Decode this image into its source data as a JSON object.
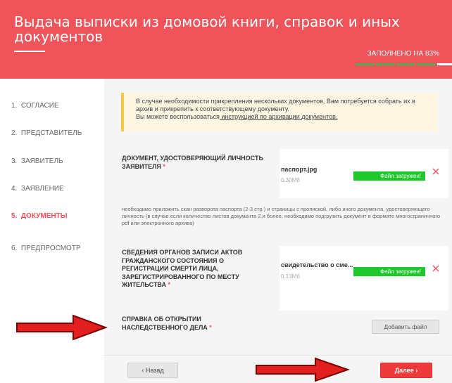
{
  "header": {
    "title": "Выдача выписки из домовой книги, справок и иных документов",
    "progress_text": "Заполнено на 83%",
    "progress": 0.83
  },
  "steps": [
    {
      "num": "1.",
      "label": "Согласие"
    },
    {
      "num": "2.",
      "label": "Представитель"
    },
    {
      "num": "3.",
      "label": "Заявитель"
    },
    {
      "num": "4.",
      "label": "Заявление"
    },
    {
      "num": "5.",
      "label": "Документы"
    },
    {
      "num": "6.",
      "label": "Предпросмотр"
    }
  ],
  "notice": {
    "text": "В случае необходимости прикрепления нескольких документов, Вам потребуется собрать их в архив и прикрепить к соответствующему документу.",
    "text2": "Вы можете воспользоваться",
    "link": " инструкцией по архивации документов."
  },
  "documents": [
    {
      "label": "Документ, удостоверяющий личность заявителя",
      "file_name": "паспорт.jpg",
      "file_size": "0.30Мб",
      "status": "Файл загружен!"
    },
    {
      "label": "Сведения органов записи актов гражданского состояния о регистрации смерти лица, зарегистрированного по месту жительства",
      "file_name": "свидетельство о сме...",
      "file_size": "0.13Мб",
      "status": "Файл загружен!"
    },
    {
      "label": "Справка об открытии наследственного дела"
    }
  ],
  "required_mark": "*",
  "hint": "необходимо приложить скан разворота паспорта (2-3 стр.) и страницы с пропиской, либо иного документа, удостоверяющего личность (в случае если количество листов документа 2 и более, необходимо подгрузить документ в формате многостраничного pdf или электронного архива)",
  "add_file_label": "Добавить файл",
  "nav": {
    "back": "‹ Назад",
    "next": "Далее ›"
  },
  "colors": {
    "accent": "#f0545b",
    "success": "#1ec82c",
    "arrow": "#e31e1e",
    "progress_done": "#4cb050"
  }
}
